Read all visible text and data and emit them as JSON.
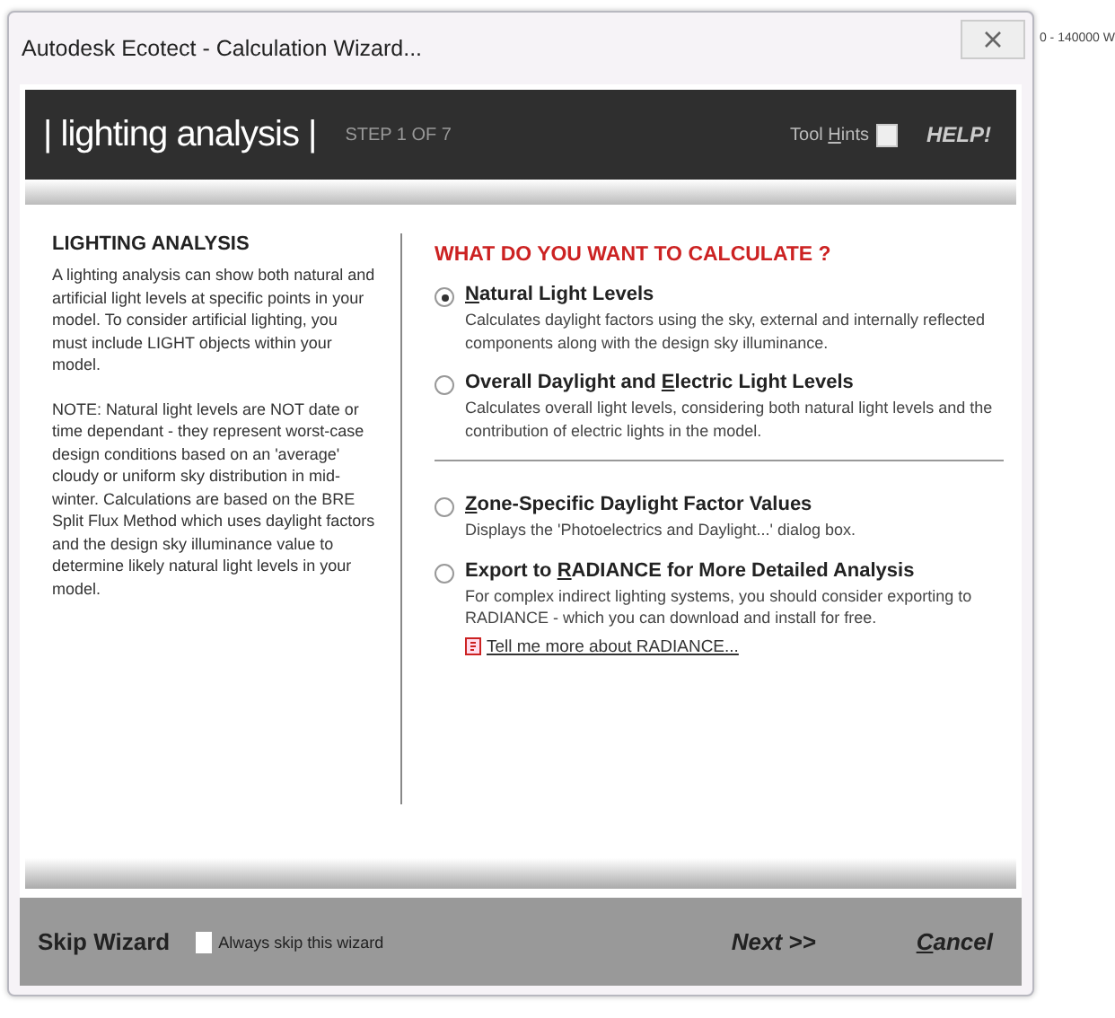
{
  "window": {
    "title": "Autodesk Ecotect - Calculation Wizard..."
  },
  "outside_text": "0 - 140000 W",
  "header": {
    "title": "| lighting analysis |",
    "step": "STEP 1 OF 7",
    "tool_hints": {
      "label": {
        "pre": "Tool ",
        "key": "H",
        "post": "ints"
      },
      "checked": false
    },
    "help": "HELP!"
  },
  "left": {
    "heading": "LIGHTING ANALYSIS",
    "paragraphs": [
      "A lighting analysis can show both natural and artificial light levels at specific points in your model. To consider artificial lighting, you must include LIGHT objects within your model.",
      "NOTE: Natural light levels are NOT date or time dependant - they represent worst-case design conditions based on an 'average' cloudy or uniform sky distribution in mid-winter. Calculations are based on the BRE Split Flux Method which uses daylight factors and the design sky illuminance value to determine likely natural light levels in your model."
    ]
  },
  "question": "WHAT DO YOU WANT TO CALCULATE ?",
  "option_groups": [
    [
      {
        "label": {
          "key": "N",
          "post": "atural Light Levels"
        },
        "description": "Calculates daylight factors using the sky, external and internally reflected components along with the design sky illuminance.",
        "selected": true
      },
      {
        "label": {
          "pre": "Overall Daylight and ",
          "key": "E",
          "post": "lectric Light Levels"
        },
        "description": "Calculates overall light levels, considering both natural light levels and the contribution of electric lights in the model.",
        "selected": false
      }
    ],
    [
      {
        "label": {
          "key": "Z",
          "post": "one-Specific Daylight Factor Values"
        },
        "description": "Displays the 'Photoelectrics and Daylight...' dialog box.",
        "selected": false
      },
      {
        "label": {
          "pre": "Export to ",
          "key": "R",
          "post": "ADIANCE for More Detailed Analysis"
        },
        "description": "For complex indirect lighting systems, you should consider exporting to RADIANCE - which you can download and install for free.",
        "selected": false,
        "link": "Tell me more about RADIANCE..."
      }
    ]
  ],
  "footer": {
    "skip": "Skip Wizard",
    "always_skip": {
      "label": "Always skip this wizard",
      "checked": false
    },
    "next": "Next >>",
    "cancel": {
      "key": "C",
      "post": "ancel"
    }
  }
}
